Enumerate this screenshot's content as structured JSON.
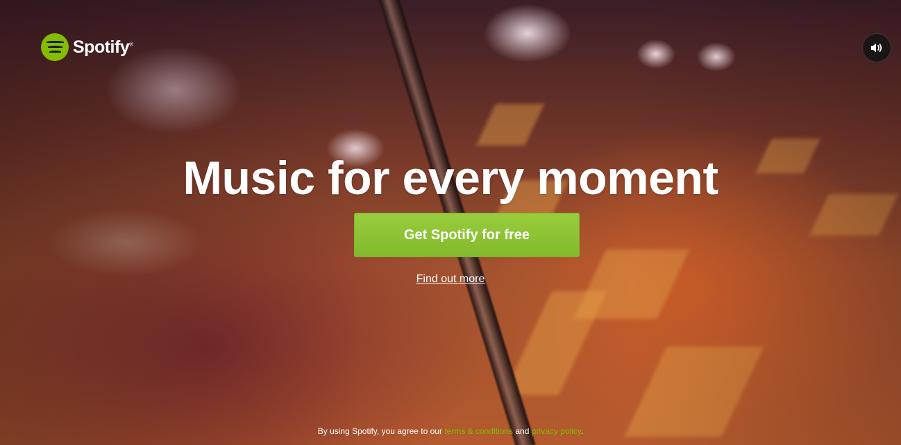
{
  "brand": {
    "name": "Spotify",
    "trademark": "®",
    "accent_color": "#84bd00"
  },
  "header": {
    "sound_icon": "speaker-volume-icon"
  },
  "hero": {
    "headline": "Music for every moment",
    "cta_label": "Get Spotify for free",
    "secondary_link": "Find out more"
  },
  "footer": {
    "legal_prefix": "By using Spotify, you agree to our",
    "terms_link": "terms & conditions",
    "conjunction": "and",
    "privacy_link": "privacy policy",
    "suffix": "."
  }
}
